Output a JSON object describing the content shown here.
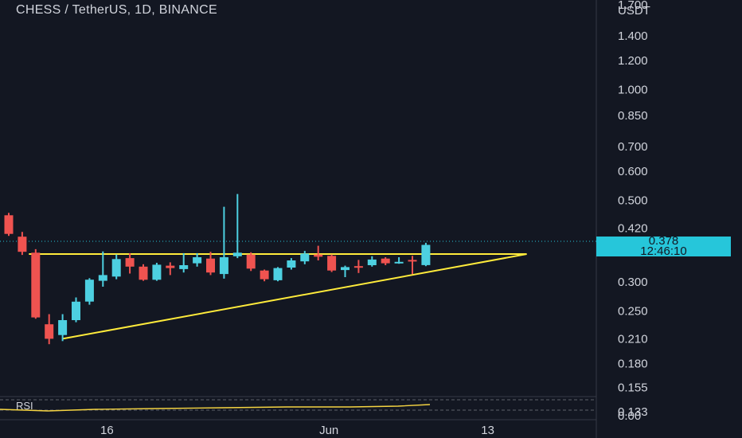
{
  "header": {
    "title": "CHESS / TetherUS, 1D, BINANCE"
  },
  "price_axis": {
    "unit": "USDT",
    "ticks": [
      "1.700",
      "1.400",
      "1.200",
      "1.000",
      "0.850",
      "0.700",
      "0.600",
      "0.500",
      "0.420",
      "0.300",
      "0.250",
      "0.210",
      "0.180",
      "0.155",
      "0.133"
    ],
    "current_price": "0.378",
    "countdown": "12:46:10"
  },
  "time_axis": {
    "ticks": [
      "16",
      "Jun",
      "13"
    ]
  },
  "rsi_pane": {
    "label": "RSI",
    "axis_tick": "0.00"
  },
  "colors": {
    "up": "#4dd0e1",
    "down": "#ef5350",
    "trendline": "#ffeb3b",
    "background": "#131722",
    "price_line": "#26c6da"
  },
  "chart_data": {
    "type": "candlestick",
    "title": "CHESS / TetherUS, 1D, BINANCE",
    "y_scale": "log",
    "y_unit": "USDT",
    "current_price": 0.378,
    "candles": [
      {
        "o": 0.455,
        "h": 0.462,
        "l": 0.4,
        "c": 0.405,
        "dir": "down"
      },
      {
        "o": 0.398,
        "h": 0.41,
        "l": 0.355,
        "c": 0.362,
        "dir": "down"
      },
      {
        "o": 0.36,
        "h": 0.368,
        "l": 0.238,
        "c": 0.24,
        "dir": "down"
      },
      {
        "o": 0.23,
        "h": 0.245,
        "l": 0.203,
        "c": 0.21,
        "dir": "down"
      },
      {
        "o": 0.215,
        "h": 0.245,
        "l": 0.207,
        "c": 0.236,
        "dir": "up"
      },
      {
        "o": 0.236,
        "h": 0.272,
        "l": 0.233,
        "c": 0.265,
        "dir": "up"
      },
      {
        "o": 0.265,
        "h": 0.307,
        "l": 0.26,
        "c": 0.304,
        "dir": "up"
      },
      {
        "o": 0.302,
        "h": 0.363,
        "l": 0.291,
        "c": 0.313,
        "dir": "up"
      },
      {
        "o": 0.31,
        "h": 0.356,
        "l": 0.305,
        "c": 0.346,
        "dir": "up"
      },
      {
        "o": 0.348,
        "h": 0.359,
        "l": 0.316,
        "c": 0.33,
        "dir": "down"
      },
      {
        "o": 0.33,
        "h": 0.335,
        "l": 0.302,
        "c": 0.304,
        "dir": "down"
      },
      {
        "o": 0.304,
        "h": 0.338,
        "l": 0.302,
        "c": 0.334,
        "dir": "up"
      },
      {
        "o": 0.332,
        "h": 0.339,
        "l": 0.313,
        "c": 0.327,
        "dir": "down"
      },
      {
        "o": 0.325,
        "h": 0.359,
        "l": 0.318,
        "c": 0.333,
        "dir": "up"
      },
      {
        "o": 0.337,
        "h": 0.359,
        "l": 0.33,
        "c": 0.35,
        "dir": "up"
      },
      {
        "o": 0.347,
        "h": 0.362,
        "l": 0.313,
        "c": 0.318,
        "dir": "down"
      },
      {
        "o": 0.315,
        "h": 0.48,
        "l": 0.306,
        "c": 0.35,
        "dir": "up"
      },
      {
        "o": 0.36,
        "h": 0.52,
        "l": 0.348,
        "c": 0.352,
        "dir": "up"
      },
      {
        "o": 0.356,
        "h": 0.361,
        "l": 0.321,
        "c": 0.326,
        "dir": "down"
      },
      {
        "o": 0.322,
        "h": 0.324,
        "l": 0.301,
        "c": 0.305,
        "dir": "down"
      },
      {
        "o": 0.303,
        "h": 0.329,
        "l": 0.301,
        "c": 0.327,
        "dir": "up"
      },
      {
        "o": 0.328,
        "h": 0.348,
        "l": 0.324,
        "c": 0.343,
        "dir": "up"
      },
      {
        "o": 0.341,
        "h": 0.364,
        "l": 0.335,
        "c": 0.358,
        "dir": "up"
      },
      {
        "o": 0.356,
        "h": 0.376,
        "l": 0.343,
        "c": 0.351,
        "dir": "down"
      },
      {
        "o": 0.353,
        "h": 0.356,
        "l": 0.319,
        "c": 0.322,
        "dir": "down"
      },
      {
        "o": 0.323,
        "h": 0.332,
        "l": 0.309,
        "c": 0.329,
        "dir": "up"
      },
      {
        "o": 0.331,
        "h": 0.344,
        "l": 0.317,
        "c": 0.331,
        "dir": "down"
      },
      {
        "o": 0.333,
        "h": 0.352,
        "l": 0.33,
        "c": 0.345,
        "dir": "up"
      },
      {
        "o": 0.347,
        "h": 0.35,
        "l": 0.333,
        "c": 0.337,
        "dir": "down"
      },
      {
        "o": 0.338,
        "h": 0.35,
        "l": 0.336,
        "c": 0.34,
        "dir": "up"
      },
      {
        "o": 0.344,
        "h": 0.353,
        "l": 0.315,
        "c": 0.342,
        "dir": "down"
      },
      {
        "o": 0.333,
        "h": 0.383,
        "l": 0.331,
        "c": 0.378,
        "dir": "up"
      }
    ],
    "trendlines": [
      {
        "name": "resistance",
        "from": {
          "candle": 1.5,
          "price": 0.357
        },
        "to": {
          "candle": 38.5,
          "price": 0.357
        }
      },
      {
        "name": "support",
        "from": {
          "candle": 4,
          "price": 0.21
        },
        "to": {
          "candle": 38.5,
          "price": 0.357
        }
      }
    ]
  }
}
